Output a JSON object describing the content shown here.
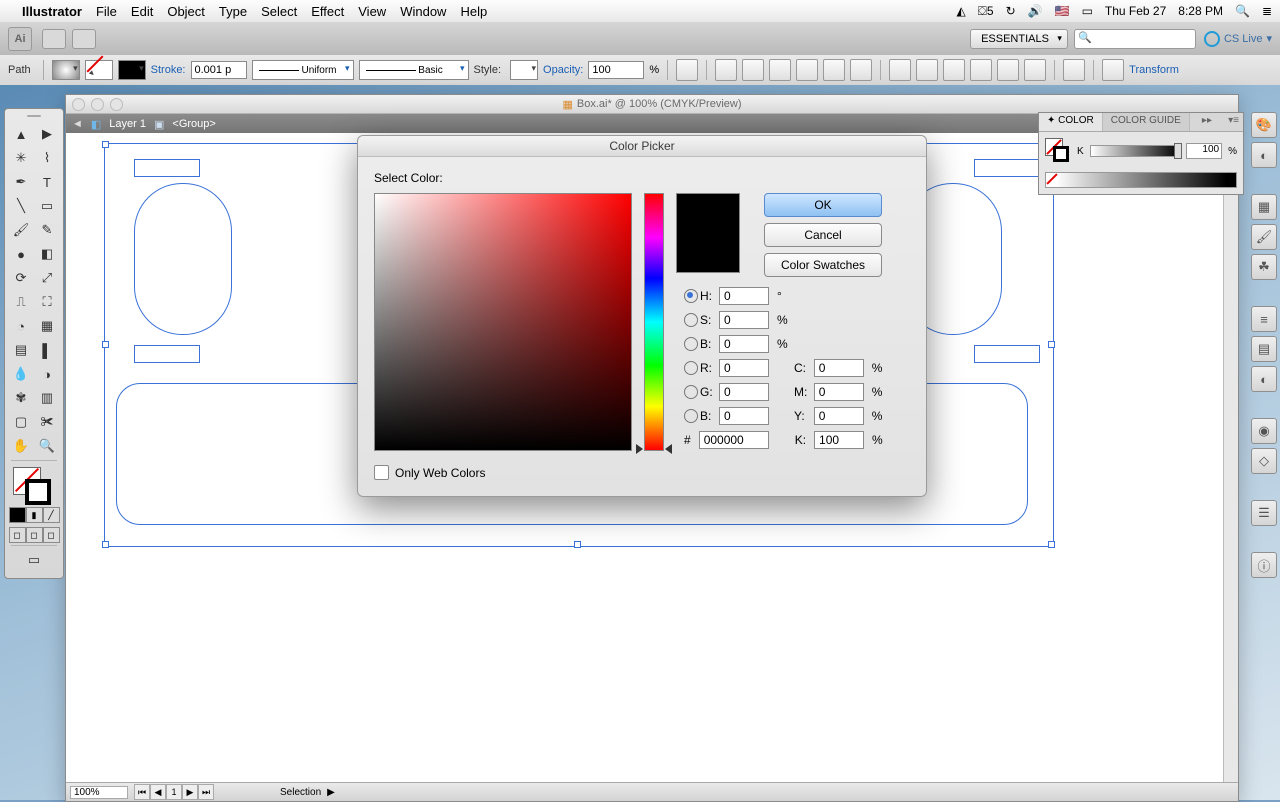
{
  "menubar": {
    "app": "Illustrator",
    "items": [
      "File",
      "Edit",
      "Object",
      "Type",
      "Select",
      "Effect",
      "View",
      "Window",
      "Help"
    ],
    "right": {
      "adobe": "5",
      "flag": "🇺🇸",
      "battery": "🔋",
      "date": "Thu Feb 27",
      "time": "8:28 PM"
    }
  },
  "appbar": {
    "ai": "Ai",
    "essentials": "ESSENTIALS",
    "cslive": "CS Live"
  },
  "optbar": {
    "path": "Path",
    "stroke": "Stroke:",
    "stroke_val": "0.001 p",
    "uniform": "Uniform",
    "basic": "Basic",
    "style": "Style:",
    "opacity": "Opacity:",
    "opacity_val": "100",
    "pct": "%",
    "transform": "Transform"
  },
  "docwin": {
    "title": "Box.ai* @ 100% (CMYK/Preview)",
    "layer": "Layer 1",
    "group": "<Group>",
    "zoom": "100%",
    "mode": "Selection",
    "page": "1"
  },
  "colorpanel": {
    "tab1": "COLOR",
    "tab2": "COLOR GUIDE",
    "k": "K",
    "kval": "100",
    "pct": "%"
  },
  "picker": {
    "title": "Color Picker",
    "select": "Select Color:",
    "ok": "OK",
    "cancel": "Cancel",
    "swatches": "Color Swatches",
    "H": "H:",
    "S": "S:",
    "Bv": "B:",
    "R": "R:",
    "G": "G:",
    "Bc": "B:",
    "C": "C:",
    "M": "M:",
    "Y": "Y:",
    "K": "K:",
    "deg": "°",
    "pct": "%",
    "hash": "#",
    "h": "0",
    "s": "0",
    "bv": "0",
    "r": "0",
    "g": "0",
    "bc": "0",
    "c": "0",
    "m": "0",
    "y": "0",
    "k": "100",
    "hex": "000000",
    "web": "Only Web Colors"
  }
}
